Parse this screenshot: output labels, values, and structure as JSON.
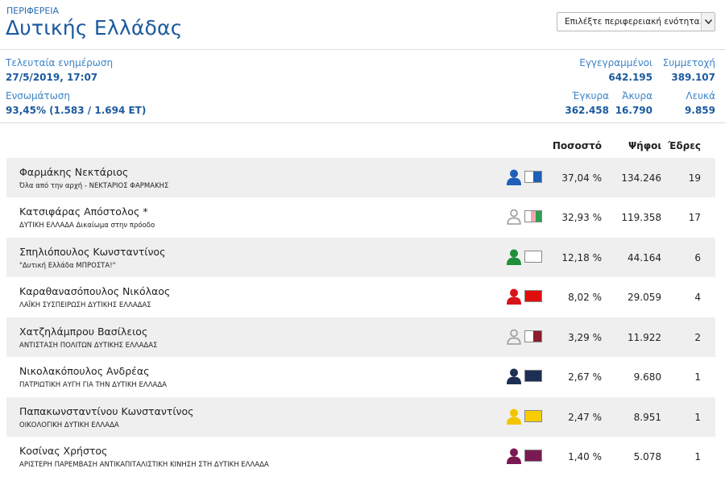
{
  "header": {
    "kicker": "ΠΕΡΙΦΕΡΕΙΑ",
    "title": "Δυτικής Ελλάδας",
    "select_text": "Επιλέξτε περιφερειακή ενότητα..."
  },
  "info": {
    "last_update_label": "Τελευταία ενημέρωση",
    "last_update_value": "27/5/2019, 17:07",
    "integration_label": "Ενσωμάτωση",
    "integration_value": "93,45% (1.583 / 1.694 ΕΤ)",
    "registered_label": "Εγγεγραμμένοι",
    "registered_value": "642.195",
    "turnout_label": "Συμμετοχή",
    "turnout_value": "389.107",
    "valid_label": "Έγκυρα",
    "valid_value": "362.458",
    "invalid_label": "Άκυρα",
    "invalid_value": "16.790",
    "blank_label": "Λευκά",
    "blank_value": "9.859"
  },
  "table": {
    "headers": {
      "percent": "Ποσοστό",
      "votes": "Ψήφοι",
      "seats": "Έδρες"
    },
    "rows": [
      {
        "name": "Φαρμάκης Νεκτάριος",
        "party": "Όλα από την αρχή - ΝΕΚΤΑΡΙΟΣ ΦΑΡΜΑΚΗΣ",
        "percent": "37,04 %",
        "votes": "134.246",
        "seats": "19",
        "person_color": "#1f5fb8",
        "swatch": [
          "#ffffff",
          "#1f5fb8"
        ]
      },
      {
        "name": "Κατσιφάρας Απόστολος *",
        "party": "ΔΥΤΙΚΗ ΕΛΛΑΔΑ Δικαίωμα στην πρόοδο",
        "percent": "32,93 %",
        "votes": "119.358",
        "seats": "17",
        "person_color": "#9a9a9a",
        "swatch": [
          "#ffffff",
          "#f2a7b2",
          "#2e9e4f"
        ]
      },
      {
        "name": "Σπηλιόπουλος Κωνσταντίνος",
        "party": "\"Δυτική Ελλάδα ΜΠΡΟΣΤΑ!\"",
        "percent": "12,18 %",
        "votes": "44.164",
        "seats": "6",
        "person_color": "#1f8f3a",
        "swatch": [
          "#ffffff"
        ]
      },
      {
        "name": "Καραθανασόπουλος Νικόλαος",
        "party": "ΛΑΪΚΗ ΣΥΣΠΕΙΡΩΣΗ ΔΥΤΙΚΗΣ ΕΛΛΑΔΑΣ",
        "percent": "8,02 %",
        "votes": "29.059",
        "seats": "4",
        "person_color": "#d8141b",
        "swatch": [
          "#e10e0e"
        ]
      },
      {
        "name": "Χατζηλάμπρου Βασίλειος",
        "party": "ΑΝΤΙΣΤΑΣΗ ΠΟΛΙΤΩΝ ΔΥΤΙΚΗΣ ΕΛΛΑΔΑΣ",
        "percent": "3,29 %",
        "votes": "11.922",
        "seats": "2",
        "person_color": "#9a9a9a",
        "swatch": [
          "#ffffff",
          "#8c1d2a"
        ]
      },
      {
        "name": "Νικολακόπουλος Ανδρέας",
        "party": "ΠΑΤΡΙΩΤΙΚΗ ΑΥΓΗ ΓΙΑ ΤΗΝ ΔΥΤΙΚΗ ΕΛΛΑΔΑ",
        "percent": "2,67 %",
        "votes": "9.680",
        "seats": "1",
        "person_color": "#1d2f52",
        "swatch": [
          "#1d2f52"
        ]
      },
      {
        "name": "Παπακωνσταντίνου Κωνσταντίνος",
        "party": "ΟΙΚΟΛΟΓΙΚΗ ΔΥΤΙΚΗ ΕΛΛΑΔΑ",
        "percent": "2,47 %",
        "votes": "8.951",
        "seats": "1",
        "person_color": "#f2c500",
        "swatch": [
          "#f7cc00"
        ]
      },
      {
        "name": "Κοσίνας Χρήστος",
        "party": "ΑΡΙΣΤΕΡΗ ΠΑΡΕΜΒΑΣΗ ΑΝΤΙΚΑΠΙΤΑΛΙΣΤΙΚΗ ΚΙΝΗΣΗ ΣΤΗ ΔΥΤΙΚΗ ΕΛΛΑΔΑ",
        "percent": "1,40 %",
        "votes": "5.078",
        "seats": "1",
        "person_color": "#7a1a52",
        "swatch": [
          "#7a1a52"
        ]
      }
    ]
  }
}
